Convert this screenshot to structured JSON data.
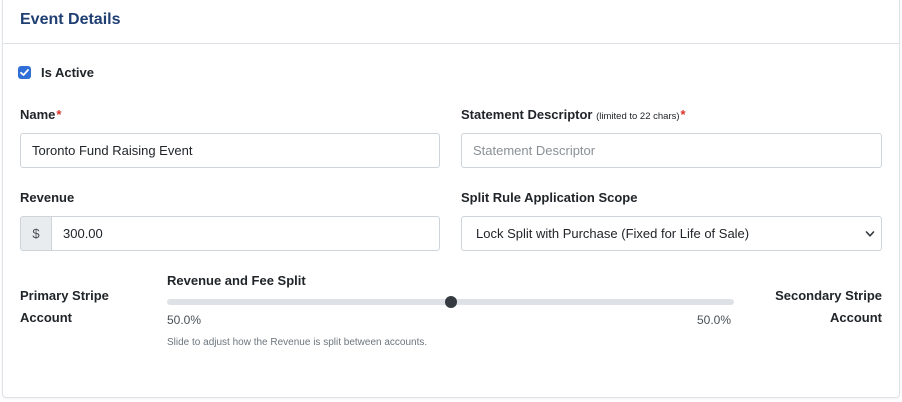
{
  "card": {
    "title": "Event Details"
  },
  "is_active": {
    "label": "Is Active",
    "checked": true
  },
  "name": {
    "label": "Name",
    "required_mark": "*",
    "value": "Toronto Fund Raising Event"
  },
  "statement_descriptor": {
    "label": "Statement Descriptor",
    "note": "(limited to 22 chars)",
    "required_mark": "*",
    "value": "",
    "placeholder": "Statement Descriptor"
  },
  "revenue": {
    "label": "Revenue",
    "currency_symbol": "$",
    "value": "300.00"
  },
  "split_scope": {
    "label": "Split Rule Application Scope",
    "selected": "Lock Split with Purchase (Fixed for Life of Sale)"
  },
  "split": {
    "label": "Revenue and Fee Split",
    "primary_label_line1": "Primary Stripe",
    "primary_label_line2": "Account",
    "secondary_label_line1": "Secondary Stripe",
    "secondary_label_line2": "Account",
    "primary_pct": "50.0%",
    "secondary_pct": "50.0%",
    "position": 0.5,
    "help": "Slide to adjust how the Revenue is split between accounts."
  },
  "colors": {
    "accent": "#2f6fd6",
    "title": "#1f3f73",
    "required": "#d9342b"
  }
}
